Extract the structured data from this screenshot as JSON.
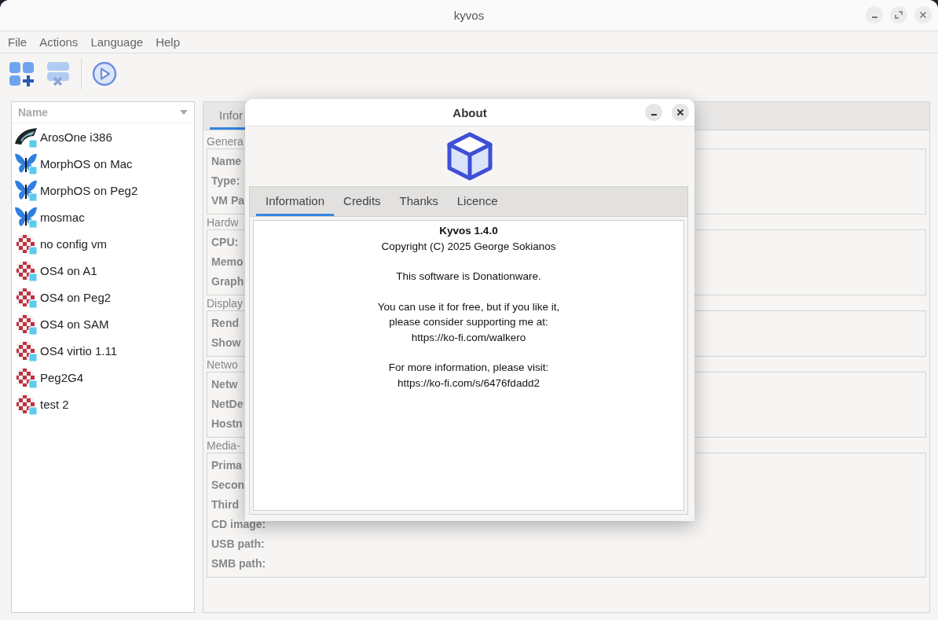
{
  "window": {
    "title": "kyvos"
  },
  "menu": [
    "File",
    "Actions",
    "Language",
    "Help"
  ],
  "toolbar": [
    {
      "kind": "add",
      "disabled": false
    },
    {
      "kind": "remove",
      "disabled": true
    },
    {
      "kind": "run",
      "disabled": false
    }
  ],
  "vm_list": {
    "column": "Name",
    "items": [
      {
        "name": "ArosOne i386",
        "kind": "aros"
      },
      {
        "name": "MorphOS on Mac",
        "kind": "morphos"
      },
      {
        "name": "MorphOS on Peg2",
        "kind": "morphos"
      },
      {
        "name": "mosmac",
        "kind": "morphos"
      },
      {
        "name": "no config vm",
        "kind": "amiga"
      },
      {
        "name": "OS4 on A1",
        "kind": "amiga"
      },
      {
        "name": "OS4 on Peg2",
        "kind": "amiga"
      },
      {
        "name": "OS4 on SAM",
        "kind": "amiga"
      },
      {
        "name": "OS4 virtio 1.11",
        "kind": "amiga"
      },
      {
        "name": "Peg2G4",
        "kind": "amiga"
      },
      {
        "name": "test 2",
        "kind": "amiga"
      }
    ]
  },
  "details": {
    "tabs": [
      {
        "label": "Infor",
        "selected": true
      }
    ],
    "groups": [
      {
        "title": "Genera",
        "fields": [
          "Name",
          "Type:",
          "VM Pa"
        ]
      },
      {
        "title": "Hardw",
        "fields": [
          "CPU:",
          "Memo",
          "Graph"
        ]
      },
      {
        "title": "Display",
        "fields": [
          "Rend",
          "Show"
        ]
      },
      {
        "title": "Netwo",
        "fields": [
          "Netw",
          "NetDe",
          "Hostn"
        ]
      },
      {
        "title": "Media-",
        "fields": [
          "Prima",
          "Secon",
          "Third",
          "CD image:",
          "USB path:",
          "SMB path:"
        ]
      }
    ]
  },
  "about": {
    "title": "About",
    "tabs": [
      {
        "label": "Information",
        "selected": true
      },
      {
        "label": "Credits",
        "selected": false
      },
      {
        "label": "Thanks",
        "selected": false
      },
      {
        "label": "Licence",
        "selected": false
      }
    ],
    "paragraphs": [
      [
        {
          "text": "Kyvos 1.4.0",
          "bold": true
        },
        {
          "text": "Copyright (C) 2025 George Sokianos",
          "bold": false
        }
      ],
      [
        {
          "text": "This software is Donationware.",
          "bold": false
        }
      ],
      [
        {
          "text": "You can use it for free, but if you like it,",
          "bold": false
        },
        {
          "text": "please consider supporting me at:",
          "bold": false
        },
        {
          "text": "https://ko-fi.com/walkero",
          "bold": false
        }
      ],
      [
        {
          "text": "For more information, please visit:",
          "bold": false
        },
        {
          "text": "https://ko-fi.com/s/6476fdadd2",
          "bold": false
        }
      ]
    ]
  }
}
